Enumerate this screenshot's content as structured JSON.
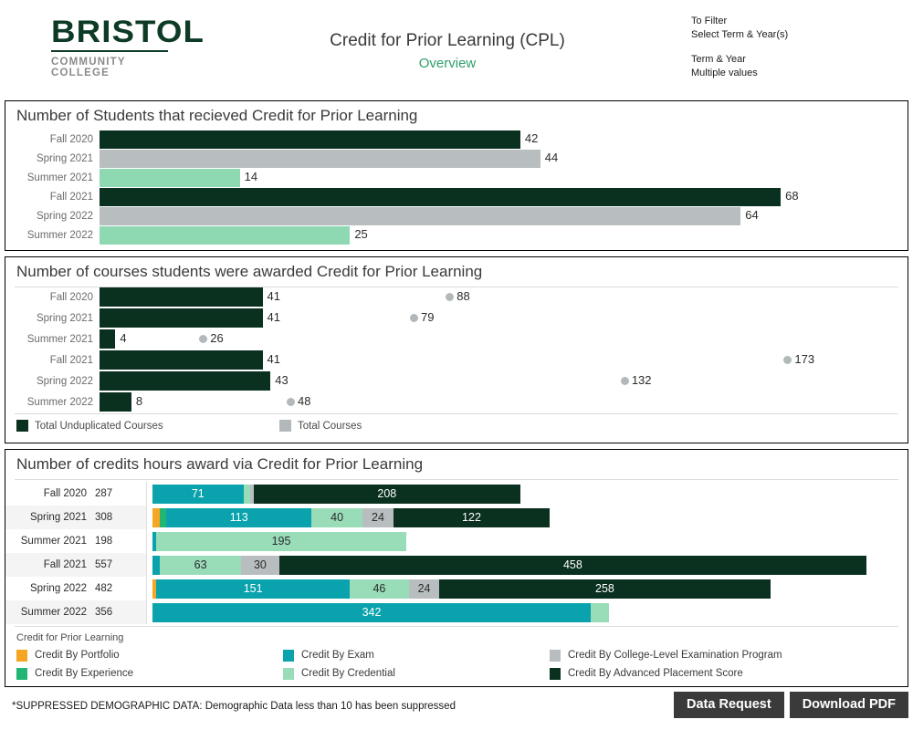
{
  "header": {
    "logo_main": "BRISTOL",
    "logo_sub": "COMMUNITY COLLEGE",
    "title": "Credit for Prior Learning (CPL)",
    "subtitle": "Overview",
    "filter_line1": "To Filter",
    "filter_line2": "Select Term & Year(s)",
    "filter_line3": "Term & Year",
    "filter_line4": "Multiple values"
  },
  "colors": {
    "portfolio": "#f5a623",
    "experience": "#22b573",
    "exam": "#0aa3ad",
    "credential": "#98dcb8",
    "clep": "#b8bdbf",
    "ap": "#0a3020",
    "dark_green": "#0a3020",
    "gray": "#b8bdbf",
    "light_green": "#8fd9b2",
    "button_bg": "#3a3a3a",
    "accent_green": "#2e9e6b"
  },
  "footer": {
    "note": "*SUPPRESSED DEMOGRAPHIC DATA: Demographic Data less than 10 has been suppressed",
    "data_request": "Data Request",
    "download_pdf": "Download PDF"
  },
  "chart_data": [
    {
      "type": "bar",
      "title": "Number of Students that recieved Credit for Prior Learning",
      "categories": [
        "Fall 2020",
        "Spring 2021",
        "Summer 2021",
        "Fall 2021",
        "Spring 2022",
        "Summer 2022"
      ],
      "values": [
        42,
        44,
        14,
        68,
        64,
        25
      ],
      "bar_colors": [
        "#0a3020",
        "#b8bdbf",
        "#8fd9b2",
        "#0a3020",
        "#b8bdbf",
        "#8fd9b2"
      ],
      "xlabel": "",
      "ylabel": "",
      "xlim": [
        0,
        74
      ],
      "grid": false,
      "legend": "none"
    },
    {
      "type": "bar",
      "title": "Number of courses students were awarded Credit for Prior Learning",
      "categories": [
        "Fall 2020",
        "Spring 2021",
        "Summer 2021",
        "Fall 2021",
        "Spring 2022",
        "Summer 2022"
      ],
      "series": [
        {
          "name": "Total Unduplicated Courses",
          "values": [
            41,
            41,
            4,
            41,
            43,
            8
          ],
          "color": "#0a3020",
          "mark": "bar"
        },
        {
          "name": "Total Courses",
          "values": [
            88,
            79,
            26,
            173,
            132,
            48
          ],
          "color": "#b3b8ba",
          "mark": "dot"
        }
      ],
      "xlabel": "",
      "ylabel": "",
      "xlim": [
        0,
        186
      ],
      "grid": false,
      "legend": "bottom"
    },
    {
      "type": "bar",
      "title": "Number of credits hours award via Credit for Prior Learning",
      "stacked": true,
      "legend_title": "Credit for Prior Learning",
      "categories": [
        "Fall 2020",
        "Spring 2021",
        "Summer 2021",
        "Fall 2021",
        "Spring 2022",
        "Summer 2022"
      ],
      "totals": [
        287,
        308,
        198,
        557,
        482,
        356
      ],
      "series": [
        {
          "name": "Credit By Portfolio",
          "color": "#f5a623",
          "values": [
            0,
            6,
            0,
            0,
            3,
            0
          ]
        },
        {
          "name": "Credit By Experience",
          "color": "#22b573",
          "values": [
            0,
            5,
            0,
            0,
            0,
            0
          ]
        },
        {
          "name": "Credit By Exam",
          "color": "#0aa3ad",
          "values": [
            71,
            113,
            3,
            6,
            151,
            342
          ]
        },
        {
          "name": "Credit By Credential",
          "color": "#98dcb8",
          "values": [
            5,
            40,
            195,
            63,
            46,
            14
          ]
        },
        {
          "name": "Credit By College-Level Examination Program",
          "color": "#b8bdbf",
          "values": [
            3,
            24,
            0,
            30,
            24,
            0
          ]
        },
        {
          "name": "Credit By Advanced Placement Score",
          "color": "#0a3020",
          "values": [
            208,
            122,
            0,
            458,
            258,
            0
          ]
        }
      ],
      "xlabel": "",
      "ylabel": "",
      "xlim": [
        0,
        560
      ],
      "grid": false,
      "legend": "bottom"
    }
  ]
}
